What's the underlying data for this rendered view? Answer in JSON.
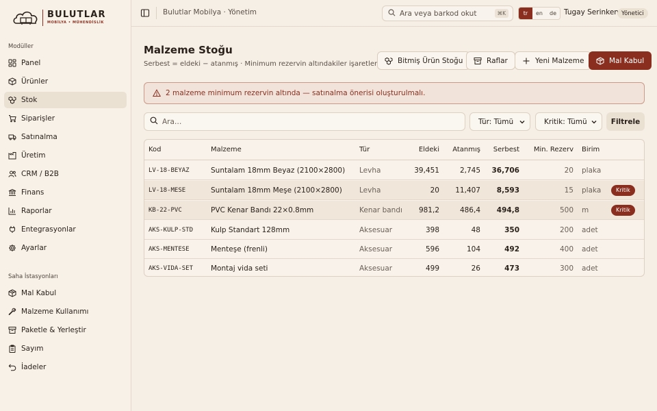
{
  "brand": {
    "name": "BULUTLAR",
    "sub": "MOBİLYA • MÜHENDİSLİK"
  },
  "sidebar": {
    "section_modules": "Modüller",
    "modules": [
      {
        "label": "Panel",
        "icon": "dashboard-icon"
      },
      {
        "label": "Ürünler",
        "icon": "box-icon"
      },
      {
        "label": "Stok",
        "icon": "boxes-icon"
      },
      {
        "label": "Siparişler",
        "icon": "cart-icon"
      },
      {
        "label": "Satınalma",
        "icon": "truck-icon"
      },
      {
        "label": "Üretim",
        "icon": "factory-icon"
      },
      {
        "label": "CRM / B2B",
        "icon": "users-icon"
      },
      {
        "label": "Finans",
        "icon": "bank-icon"
      },
      {
        "label": "Raporlar",
        "icon": "chart-icon"
      },
      {
        "label": "Entegrasyonlar",
        "icon": "plug-icon"
      },
      {
        "label": "Ayarlar",
        "icon": "gear-icon"
      }
    ],
    "section_stations": "Saha İstasyonları",
    "stations": [
      {
        "label": "Mal Kabul",
        "icon": "package-icon"
      },
      {
        "label": "Malzeme Kullanımı",
        "icon": "wrench-icon"
      },
      {
        "label": "Paketle & Yerleştir",
        "icon": "archive-icon"
      },
      {
        "label": "Sayım",
        "icon": "clipboard-icon"
      },
      {
        "label": "İadeler",
        "icon": "undo-icon"
      }
    ]
  },
  "topbar": {
    "breadcrumb": "Bulutlar Mobilya · Yönetim",
    "search_placeholder": "Ara veya barkod okut",
    "search_shortcut": "⌘K",
    "languages": [
      "tr",
      "en",
      "de"
    ],
    "active_language": "tr",
    "user_name": "Tugay Serinken",
    "user_role": "Yönetici"
  },
  "page": {
    "title": "Malzeme Stoğu",
    "subtitle": "Serbest = eldeki − atanmış · Minimum rezervin altındakiler işaretlenir.",
    "buttons": {
      "finished_stock": "Bitmiş Ürün Stoğu",
      "shelves": "Raflar",
      "new_material": "Yeni Malzeme",
      "goods_receipt": "Mal Kabul"
    },
    "alert": "2 malzeme minimum rezervin altında — satınalma önerisi oluşturulmalı.",
    "filters": {
      "search_placeholder": "Ara…",
      "type": "Tür: Tümü",
      "critical": "Kritik: Tümü",
      "apply": "Filtrele"
    }
  },
  "table": {
    "headers": {
      "kod": "Kod",
      "malzeme": "Malzeme",
      "tur": "Tür",
      "eldeki": "Eldeki",
      "atanmis": "Atanmış",
      "serbest": "Serbest",
      "min_rezerv": "Min. Rezerv",
      "birim": "Birim"
    },
    "rows": [
      {
        "kod": "LV-18-BEYAZ",
        "malzeme": "Suntalam 18mm Beyaz (2100×2800)",
        "tur": "Levha",
        "eldeki": "39,451",
        "atanmis": "2,745",
        "serbest": "36,706",
        "min_rezerv": "20",
        "birim": "plaka",
        "badge": ""
      },
      {
        "kod": "LV-18-MESE",
        "malzeme": "Suntalam 18mm Meşe (2100×2800)",
        "tur": "Levha",
        "eldeki": "20",
        "atanmis": "11,407",
        "serbest": "8,593",
        "min_rezerv": "15",
        "birim": "plaka",
        "badge": "Kritik"
      },
      {
        "kod": "KB-22-PVC",
        "malzeme": "PVC Kenar Bandı 22×0.8mm",
        "tur": "Kenar bandı",
        "eldeki": "981,2",
        "atanmis": "486,4",
        "serbest": "494,8",
        "min_rezerv": "500",
        "birim": "m",
        "badge": "Kritik"
      },
      {
        "kod": "AKS-KULP-STD",
        "malzeme": "Kulp Standart 128mm",
        "tur": "Aksesuar",
        "eldeki": "398",
        "atanmis": "48",
        "serbest": "350",
        "min_rezerv": "200",
        "birim": "adet",
        "badge": ""
      },
      {
        "kod": "AKS-MENTESE",
        "malzeme": "Menteşe (frenli)",
        "tur": "Aksesuar",
        "eldeki": "596",
        "atanmis": "104",
        "serbest": "492",
        "min_rezerv": "400",
        "birim": "adet",
        "badge": ""
      },
      {
        "kod": "AKS-VIDA-SET",
        "malzeme": "Montaj vida seti",
        "tur": "Aksesuar",
        "eldeki": "499",
        "atanmis": "26",
        "serbest": "473",
        "min_rezerv": "300",
        "birim": "adet",
        "badge": ""
      }
    ]
  },
  "colors": {
    "accent": "#8a2f1f",
    "background": "#f6efe6",
    "sidebar": "#f7f1e8",
    "alert_bg": "#f1e3d9"
  }
}
